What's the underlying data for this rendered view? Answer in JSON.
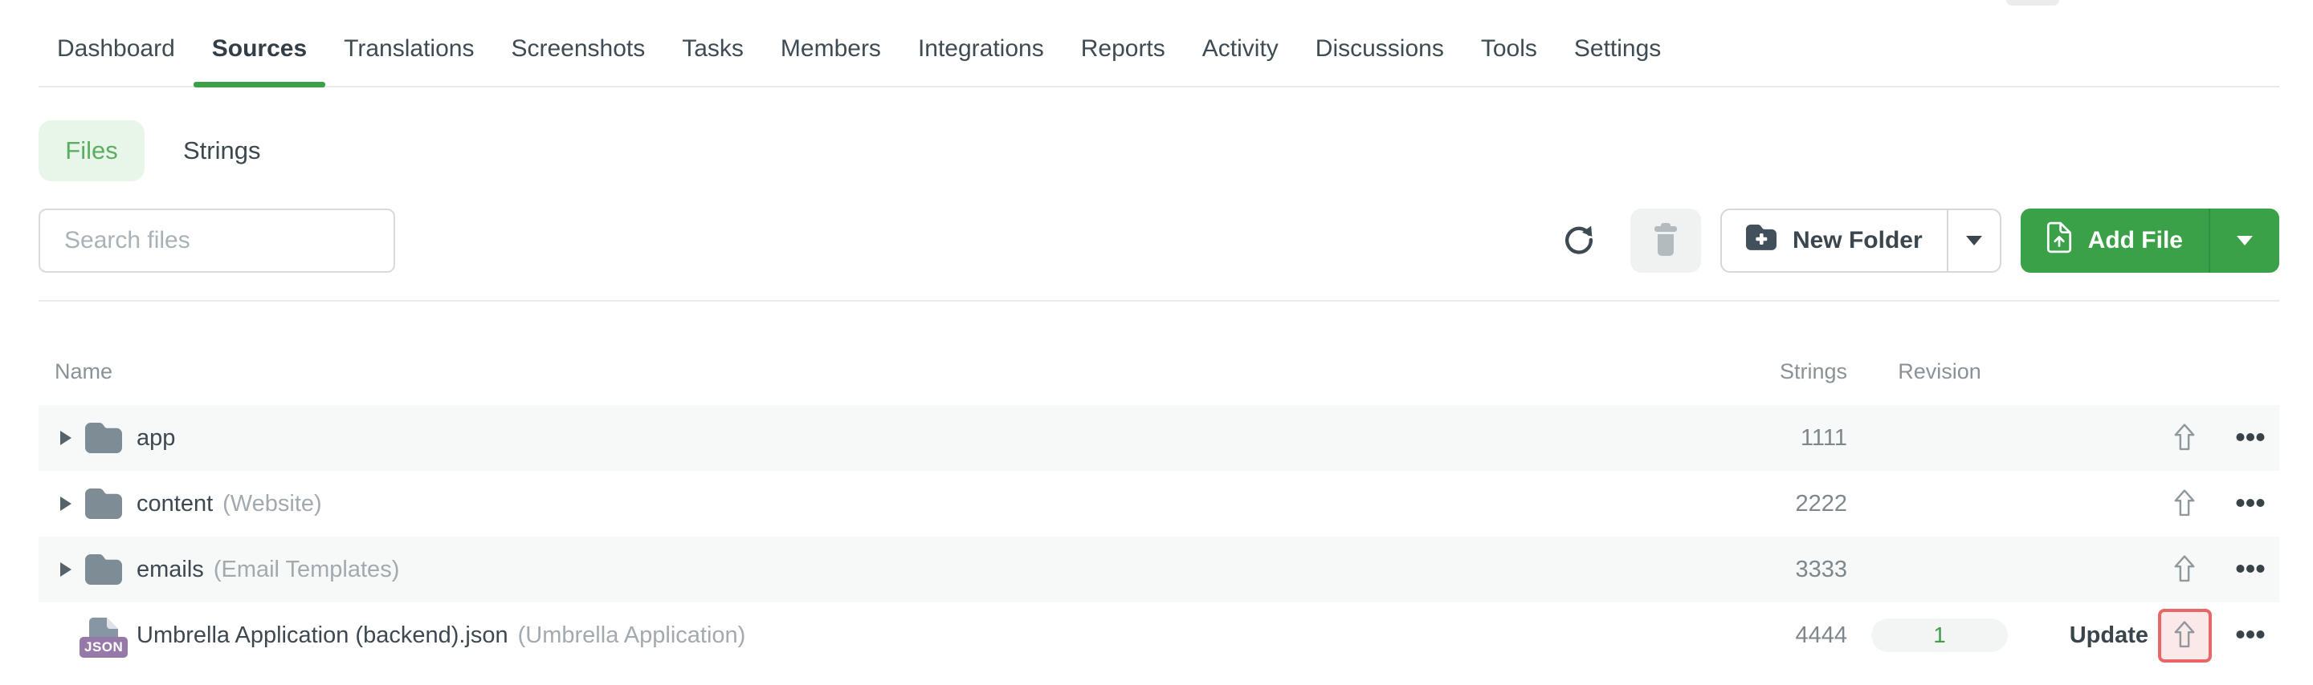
{
  "nav": {
    "tabs": [
      {
        "label": "Dashboard",
        "active": false
      },
      {
        "label": "Sources",
        "active": true
      },
      {
        "label": "Translations",
        "active": false
      },
      {
        "label": "Screenshots",
        "active": false
      },
      {
        "label": "Tasks",
        "active": false
      },
      {
        "label": "Members",
        "active": false
      },
      {
        "label": "Integrations",
        "active": false
      },
      {
        "label": "Reports",
        "active": false
      },
      {
        "label": "Activity",
        "active": false
      },
      {
        "label": "Discussions",
        "active": false
      },
      {
        "label": "Tools",
        "active": false
      },
      {
        "label": "Settings",
        "active": false
      }
    ]
  },
  "view_toggle": {
    "files_label": "Files",
    "strings_label": "Strings",
    "selected": "Files"
  },
  "toolbar": {
    "search_placeholder": "Search files",
    "search_value": "",
    "new_folder_label": "New Folder",
    "add_file_label": "Add File"
  },
  "table": {
    "headers": {
      "name": "Name",
      "strings": "Strings",
      "revision": "Revision"
    },
    "rows": [
      {
        "type": "folder",
        "name": "app",
        "note": "",
        "strings": "1111",
        "revision": "",
        "update": "",
        "highlighted": false
      },
      {
        "type": "folder",
        "name": "content",
        "note": "(Website)",
        "strings": "2222",
        "revision": "",
        "update": "",
        "highlighted": false
      },
      {
        "type": "folder",
        "name": "emails",
        "note": "(Email Templates)",
        "strings": "3333",
        "revision": "",
        "update": "",
        "highlighted": false
      },
      {
        "type": "file",
        "name": "Umbrella Application (backend).json",
        "note": "(Umbrella Application)",
        "strings": "4444",
        "revision": "1",
        "update": "Update",
        "highlighted": true,
        "badge": "JSON"
      }
    ]
  },
  "icons": {
    "refresh": "circular-arrow",
    "delete": "trash",
    "new_folder": "folder-plus",
    "add_file": "file-with-up-arrow",
    "dropdown": "caret-down",
    "expand": "chevron-right",
    "folder": "solid-folder",
    "json_file": "document-with-json-badge",
    "upload": "outline-up-arrow",
    "more": "horizontal-ellipsis"
  },
  "colors": {
    "accent_green": "#3aa148",
    "files_pill_bg": "#e8f5e9",
    "files_pill_text": "#5cad62",
    "revision_badge_text": "#3da04b",
    "json_badge_purple": "#9779a9",
    "highlight_border": "#e86666",
    "highlight_bg": "#fbe9e9",
    "row_alt_bg": "#f7f8f8"
  }
}
